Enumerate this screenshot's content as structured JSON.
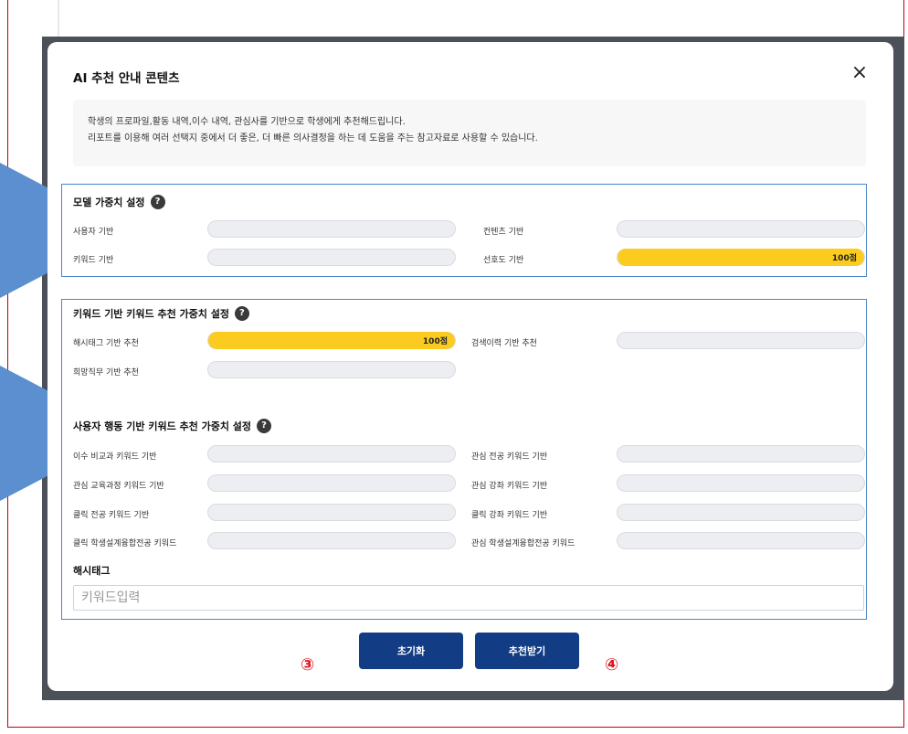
{
  "modal": {
    "title": "AI 추천 안내 콘텐츠",
    "close_icon": "×",
    "notice_line1": "학생의 프로파일,활동 내역,이수 내역, 관심사를 기반으로 학생에게 추천해드립니다.",
    "notice_line2": "리포트를 이용해 여러 선택지 중에서 더 좋은, 더 빠른 의사결정을 하는 데 도움을 주는 참고자료로 사용할 수 있습니다."
  },
  "model_weights": {
    "title": "모델 가중치 설정",
    "help": "?",
    "items": [
      {
        "label": "사용자 기반",
        "value": 0,
        "value_text": ""
      },
      {
        "label": "컨텐츠 기반",
        "value": 0,
        "value_text": ""
      },
      {
        "label": "키워드 기반",
        "value": 0,
        "value_text": ""
      },
      {
        "label": "선호도 기반",
        "value": 100,
        "value_text": "100점"
      }
    ]
  },
  "keyword_weights": {
    "title": "키워드 기반 키워드 추천 가중치 설정",
    "help": "?",
    "items": [
      {
        "label": "해시태그 기반 추천",
        "value": 100,
        "value_text": "100점"
      },
      {
        "label": "검색이력 기반 추천",
        "value": 0,
        "value_text": ""
      },
      {
        "label": "희망직무 기반 추천",
        "value": 0,
        "value_text": ""
      }
    ]
  },
  "behavior_weights": {
    "title": "사용자 행동 기반 키워드 추천 가중치 설정",
    "help": "?",
    "items": [
      {
        "label": "이수 비교과 키워드 기반",
        "value": 0
      },
      {
        "label": "관심 전공 키워드 기반",
        "value": 0
      },
      {
        "label": "관심 교육과정 키워드 기반",
        "value": 0
      },
      {
        "label": "관심 강좌 키워드 기반",
        "value": 0
      },
      {
        "label": "클릭 전공 키워드 기반",
        "value": 0
      },
      {
        "label": "클릭 강좌 키워드 기반",
        "value": 0
      },
      {
        "label": "클릭 학생설계융합전공 키워드",
        "value": 0
      },
      {
        "label": "관심 학생설계융합전공 키워드",
        "value": 0
      }
    ]
  },
  "hashtag": {
    "label": "해시태그",
    "placeholder": "키워드입력"
  },
  "buttons": {
    "reset": "초기화",
    "recommend": "추천받기"
  },
  "markers": {
    "three": "③",
    "four": "④"
  },
  "colors": {
    "accent_fill": "#fbcc1f",
    "button_bg": "#123c84",
    "section_border": "#4a86c8",
    "annotation_red": "#e0111e"
  }
}
